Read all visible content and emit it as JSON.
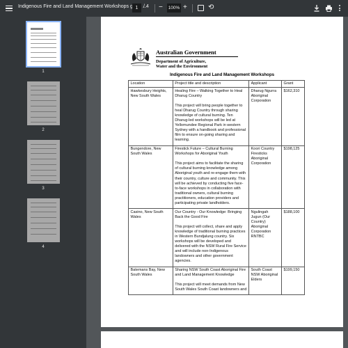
{
  "toolbar": {
    "title": "Indigenous Fire and Land Management Workshops grant ...",
    "page_current": "1",
    "page_total": "/ 4",
    "zoom": "100%",
    "zoom_out": "−",
    "zoom_in": "+",
    "rotate": "⟲"
  },
  "sidebar": {
    "thumbnails": [
      {
        "label": "1",
        "selected": true
      },
      {
        "label": "2",
        "selected": false
      },
      {
        "label": "3",
        "selected": false
      },
      {
        "label": "4",
        "selected": false
      }
    ]
  },
  "document": {
    "gov_title": "Australian Government",
    "dept_line1": "Department of Agriculture,",
    "dept_line2": "Water and the Environment",
    "heading": "Indigenous Fire and Land Management Workshops",
    "columns": [
      "Location",
      "Project title and description",
      "Applicant",
      "Grant"
    ],
    "rows": [
      {
        "location": "Hawkesbury Heights, New South Wales",
        "title": "Healing Fire – Walking Together to Heal Dharug Country",
        "description": "This project will bring people together to heal Dharug Country through sharing knowledge of cultural burning. Ten Dharug-led workshops will be led at Yellomundee Regional Park in western Sydney with a handbook and professional film to ensure on-going sharing and learning.",
        "applicant": "Dharug Ngurra Aboriginal Corporation",
        "grant": "$162,310"
      },
      {
        "location": "Bungendore, New South Wales",
        "title": "Firestick Future – Cultural Burning Workshops for Aboriginal Youth",
        "description": "This project aims to facilitate the sharing of cultural burning knowledge among Aboriginal youth and re-engage them with their country, culture and community. This will be achieved by conducting five face-to-face workshops in collaboration with traditional owners, cultural burning practitioners, education providers and participating private landholders.",
        "applicant": "Koori Country Firesticks Aboriginal Corporation",
        "grant": "$198,125"
      },
      {
        "location": "Casino, New South Wales",
        "title": "Our Country - Our Knowledge: Bringing Back the Good Fire",
        "description": "This project will collect, share and apply knowledge of traditional burning practices in Western Bundjalung country. Six workshops will be developed and delivered with the NSW Rural Fire Service and will include non-Indigenous landowners and other government agencies.",
        "applicant": "Ngulingah Jugun (Our Country) Aboriginal Corporation RNTBC",
        "grant": "$188,100"
      },
      {
        "location": "Batemans Bay, New South Wales",
        "title": "Sharing NSW South Coast Aboriginal Fire and Land Management Knowledge",
        "description": "This project will meet demands from New South Wales South Coast landowners and",
        "applicant": "South Coast NSW Aboriginal Elders",
        "grant": "$199,150"
      }
    ]
  }
}
